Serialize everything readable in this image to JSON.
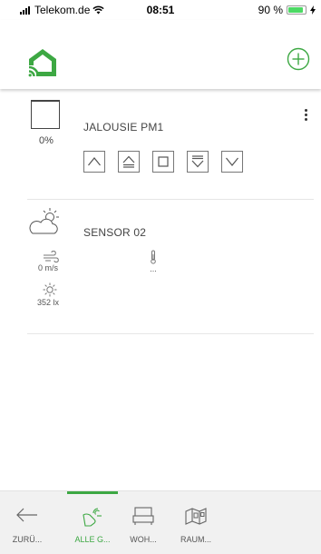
{
  "status_bar": {
    "carrier": "Telekom.de",
    "time": "08:51",
    "battery_text": "90 %",
    "battery_level": 0.9
  },
  "header": {
    "logo_icon": "home-wifi-logo-icon",
    "add_icon": "plus-circle-icon"
  },
  "devices": [
    {
      "name": "JALOUSIE PM1",
      "position_text": "0%",
      "icon": "blind-icon",
      "controls": [
        "arrow-up-icon",
        "full-up-icon",
        "stop-icon",
        "full-down-icon",
        "arrow-down-icon"
      ]
    },
    {
      "name": "SENSOR 02",
      "icon": "partly-sunny-icon",
      "wind": "0 m/s",
      "brightness": "352 lx",
      "temperature": "..."
    }
  ],
  "tabs": [
    {
      "label": "ZURÜ...",
      "icon": "back-arrow-icon",
      "active": false
    },
    {
      "label": "ALLE G...",
      "icon": "all-devices-icon",
      "active": true
    },
    {
      "label": "WOH...",
      "icon": "sofa-icon",
      "active": false
    },
    {
      "label": "RAUM...",
      "icon": "room-map-icon",
      "active": false
    }
  ],
  "colors": {
    "accent": "#3da843",
    "battery": "#4cd964",
    "tabbar_bg": "#f1f1f1"
  }
}
